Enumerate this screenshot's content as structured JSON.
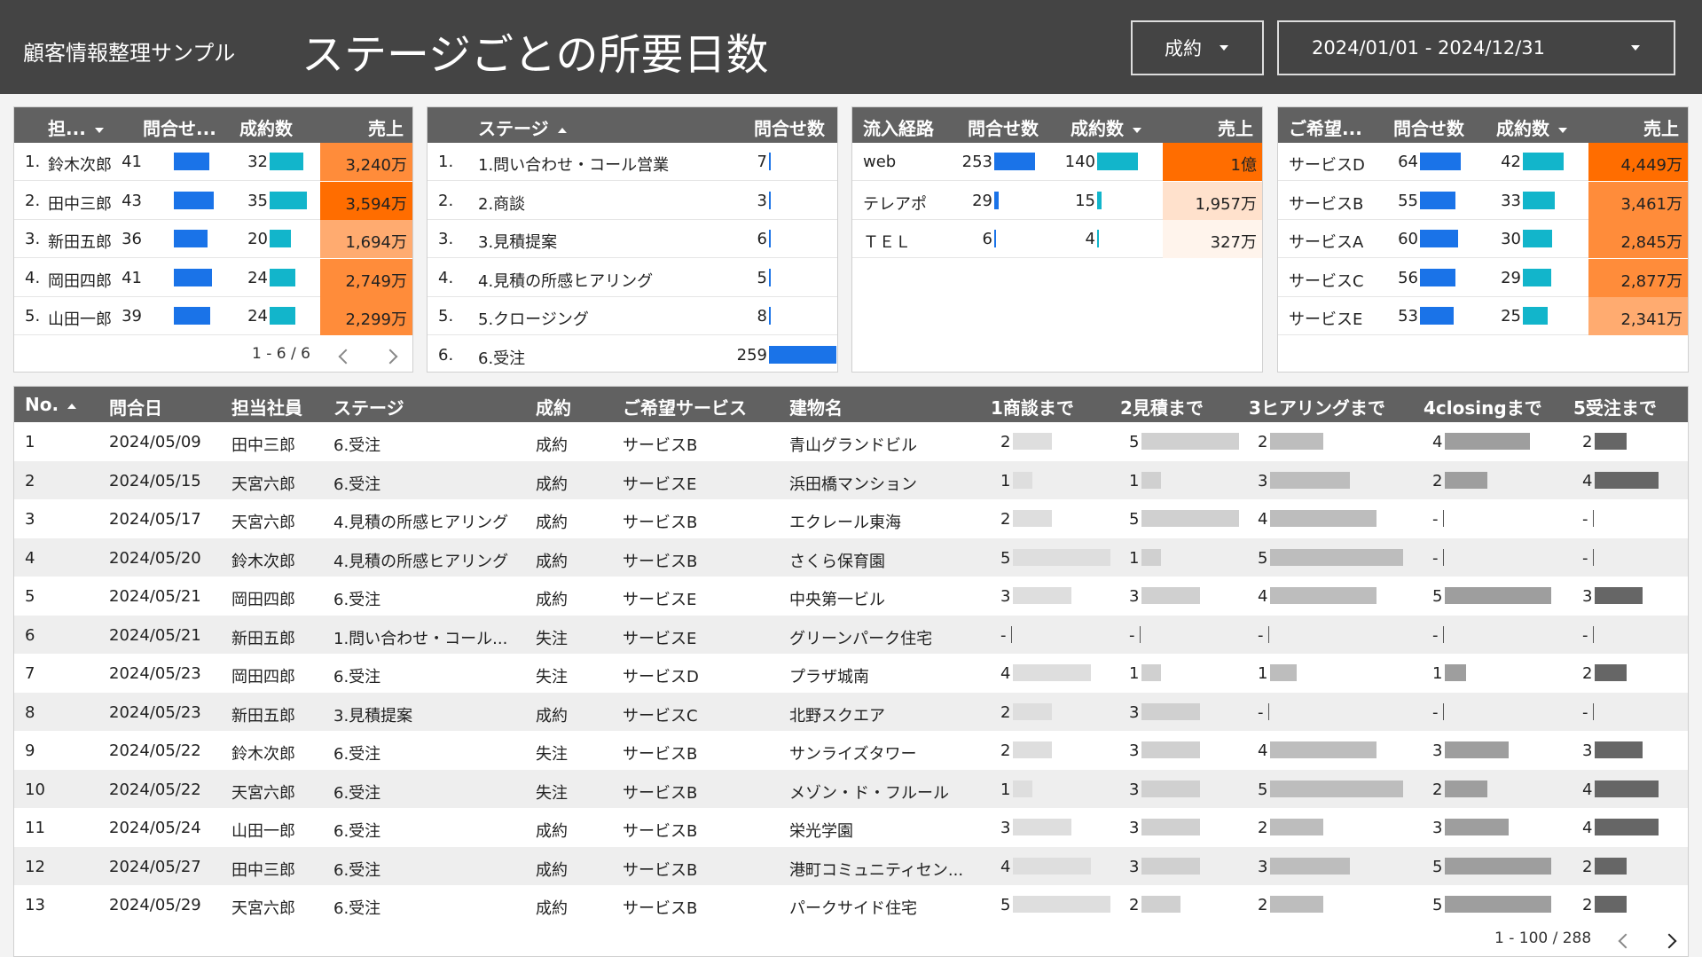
{
  "header": {
    "app_title": "顧客情報整理サンプル",
    "page_title": "ステージごとの所要日数",
    "filter_value": "成約",
    "date_range": "2024/01/01 - 2024/12/31"
  },
  "colors": {
    "header_bg": "#444444",
    "table_header_bg": "#616161",
    "bar_blue": "#1a73e8",
    "bar_teal": "#12b5cb",
    "sales_heat": [
      "#ff6d00",
      "#ff8c3a",
      "#ffab70",
      "#ffe1cc",
      "#fff4ec"
    ]
  },
  "staff_table": {
    "headers": [
      "担...",
      "問合せ...",
      "成約数",
      "売上"
    ],
    "rows": [
      {
        "idx": "1.",
        "name": "鈴木次郎",
        "inquiries": "41",
        "contracts": "32",
        "sales": "3,240万",
        "inq_frac": 0.89,
        "con_frac": 0.91,
        "heat": 1
      },
      {
        "idx": "2.",
        "name": "田中三郎",
        "inquiries": "43",
        "contracts": "35",
        "sales": "3,594万",
        "inq_frac": 1.0,
        "con_frac": 1.0,
        "heat": 0
      },
      {
        "idx": "3.",
        "name": "新田五郎",
        "inquiries": "36",
        "contracts": "20",
        "sales": "1,694万",
        "inq_frac": 0.84,
        "con_frac": 0.57,
        "heat": 2
      },
      {
        "idx": "4.",
        "name": "岡田四郎",
        "inquiries": "41",
        "contracts": "24",
        "sales": "2,749万",
        "inq_frac": 0.95,
        "con_frac": 0.69,
        "heat": 1
      },
      {
        "idx": "5.",
        "name": "山田一郎",
        "inquiries": "39",
        "contracts": "24",
        "sales": "2,299万",
        "inq_frac": 0.91,
        "con_frac": 0.69,
        "heat": 1
      }
    ],
    "pager": "1 - 6 / 6"
  },
  "stage_table": {
    "headers": [
      "ステージ",
      "問合せ数"
    ],
    "rows": [
      {
        "idx": "1.",
        "stage": "1.問い合わせ・コール営業",
        "count": "7",
        "frac": 0.027
      },
      {
        "idx": "2.",
        "stage": "2.商談",
        "count": "3",
        "frac": 0.012
      },
      {
        "idx": "3.",
        "stage": "3.見積提案",
        "count": "6",
        "frac": 0.023
      },
      {
        "idx": "4.",
        "stage": "4.見積の所感ヒアリング",
        "count": "5",
        "frac": 0.019
      },
      {
        "idx": "5.",
        "stage": "5.クロージング",
        "count": "8",
        "frac": 0.031
      },
      {
        "idx": "6.",
        "stage": "6.受注",
        "count": "259",
        "frac": 1.0
      }
    ]
  },
  "channel_table": {
    "headers": [
      "流入経路",
      "問合せ数",
      "成約数",
      "売上"
    ],
    "rows": [
      {
        "name": "web",
        "inquiries": "253",
        "contracts": "140",
        "sales": "1億",
        "inq_frac": 1.0,
        "con_frac": 1.0,
        "heat": 0
      },
      {
        "name": "テレアポ",
        "inquiries": "29",
        "contracts": "15",
        "sales": "1,957万",
        "inq_frac": 0.115,
        "con_frac": 0.107,
        "heat": 3
      },
      {
        "name": "ＴＥＬ",
        "inquiries": "6",
        "contracts": "4",
        "sales": "327万",
        "inq_frac": 0.024,
        "con_frac": 0.029,
        "heat": 4
      }
    ]
  },
  "service_table": {
    "headers": [
      "ご希望...",
      "問合せ数",
      "成約数",
      "売上"
    ],
    "rows": [
      {
        "name": "サービスD",
        "inquiries": "64",
        "contracts": "42",
        "sales": "4,449万",
        "inq_frac": 1.0,
        "con_frac": 1.0,
        "heat": 0
      },
      {
        "name": "サービスB",
        "inquiries": "55",
        "contracts": "33",
        "sales": "3,461万",
        "inq_frac": 0.86,
        "con_frac": 0.79,
        "heat": 1
      },
      {
        "name": "サービスA",
        "inquiries": "60",
        "contracts": "30",
        "sales": "2,845万",
        "inq_frac": 0.94,
        "con_frac": 0.71,
        "heat": 1
      },
      {
        "name": "サービスC",
        "inquiries": "56",
        "contracts": "29",
        "sales": "2,877万",
        "inq_frac": 0.88,
        "con_frac": 0.69,
        "heat": 1
      },
      {
        "name": "サービスE",
        "inquiries": "53",
        "contracts": "25",
        "sales": "2,341万",
        "inq_frac": 0.83,
        "con_frac": 0.6,
        "heat": 2
      }
    ]
  },
  "detail_table": {
    "headers": [
      "No.",
      "問合日",
      "担当社員",
      "ステージ",
      "成約",
      "ご希望サービス",
      "建物名",
      "1商談まで",
      "2見積まで",
      "3ヒアリングまで",
      "4closingまで",
      "5受注まで"
    ],
    "rows": [
      {
        "no": "1",
        "date": "2024/05/09",
        "staff": "田中三郎",
        "stage": "6.受注",
        "result": "成約",
        "service": "サービスB",
        "building": "青山グランドビル",
        "d": [
          "2",
          "5",
          "2",
          "4",
          "2"
        ]
      },
      {
        "no": "2",
        "date": "2024/05/15",
        "staff": "天宮六郎",
        "stage": "6.受注",
        "result": "成約",
        "service": "サービスE",
        "building": "浜田橋マンション",
        "d": [
          "1",
          "1",
          "3",
          "2",
          "4"
        ]
      },
      {
        "no": "3",
        "date": "2024/05/17",
        "staff": "天宮六郎",
        "stage": "4.見積の所感ヒアリング",
        "result": "成約",
        "service": "サービスB",
        "building": "エクレール東海",
        "d": [
          "2",
          "5",
          "4",
          "-",
          "-"
        ]
      },
      {
        "no": "4",
        "date": "2024/05/20",
        "staff": "鈴木次郎",
        "stage": "4.見積の所感ヒアリング",
        "result": "成約",
        "service": "サービスB",
        "building": "さくら保育園",
        "d": [
          "5",
          "1",
          "5",
          "-",
          "-"
        ]
      },
      {
        "no": "5",
        "date": "2024/05/21",
        "staff": "岡田四郎",
        "stage": "6.受注",
        "result": "成約",
        "service": "サービスE",
        "building": "中央第一ビル",
        "d": [
          "3",
          "3",
          "4",
          "5",
          "3"
        ]
      },
      {
        "no": "6",
        "date": "2024/05/21",
        "staff": "新田五郎",
        "stage": "1.問い合わせ・コール...",
        "result": "失注",
        "service": "サービスE",
        "building": "グリーンパーク住宅",
        "d": [
          "-",
          "-",
          "-",
          "-",
          "-"
        ]
      },
      {
        "no": "7",
        "date": "2024/05/23",
        "staff": "岡田四郎",
        "stage": "6.受注",
        "result": "失注",
        "service": "サービスD",
        "building": "プラザ城南",
        "d": [
          "4",
          "1",
          "1",
          "1",
          "2"
        ]
      },
      {
        "no": "8",
        "date": "2024/05/23",
        "staff": "新田五郎",
        "stage": "3.見積提案",
        "result": "成約",
        "service": "サービスC",
        "building": "北野スクエア",
        "d": [
          "2",
          "3",
          "-",
          "-",
          "-"
        ]
      },
      {
        "no": "9",
        "date": "2024/05/22",
        "staff": "鈴木次郎",
        "stage": "6.受注",
        "result": "失注",
        "service": "サービスB",
        "building": "サンライズタワー",
        "d": [
          "2",
          "3",
          "4",
          "3",
          "3"
        ]
      },
      {
        "no": "10",
        "date": "2024/05/22",
        "staff": "天宮六郎",
        "stage": "6.受注",
        "result": "失注",
        "service": "サービスB",
        "building": "メゾン・ド・フルール",
        "d": [
          "1",
          "3",
          "5",
          "2",
          "4"
        ]
      },
      {
        "no": "11",
        "date": "2024/05/24",
        "staff": "山田一郎",
        "stage": "6.受注",
        "result": "成約",
        "service": "サービスB",
        "building": "栄光学園",
        "d": [
          "3",
          "3",
          "2",
          "3",
          "4"
        ]
      },
      {
        "no": "12",
        "date": "2024/05/27",
        "staff": "田中三郎",
        "stage": "6.受注",
        "result": "成約",
        "service": "サービスB",
        "building": "港町コミュニティセン...",
        "d": [
          "4",
          "3",
          "3",
          "5",
          "2"
        ]
      },
      {
        "no": "13",
        "date": "2024/05/29",
        "staff": "天宮六郎",
        "stage": "6.受注",
        "result": "成約",
        "service": "サービスB",
        "building": "パークサイド住宅",
        "d": [
          "5",
          "2",
          "2",
          "5",
          "2"
        ]
      }
    ],
    "pager": "1 - 100 / 288"
  }
}
